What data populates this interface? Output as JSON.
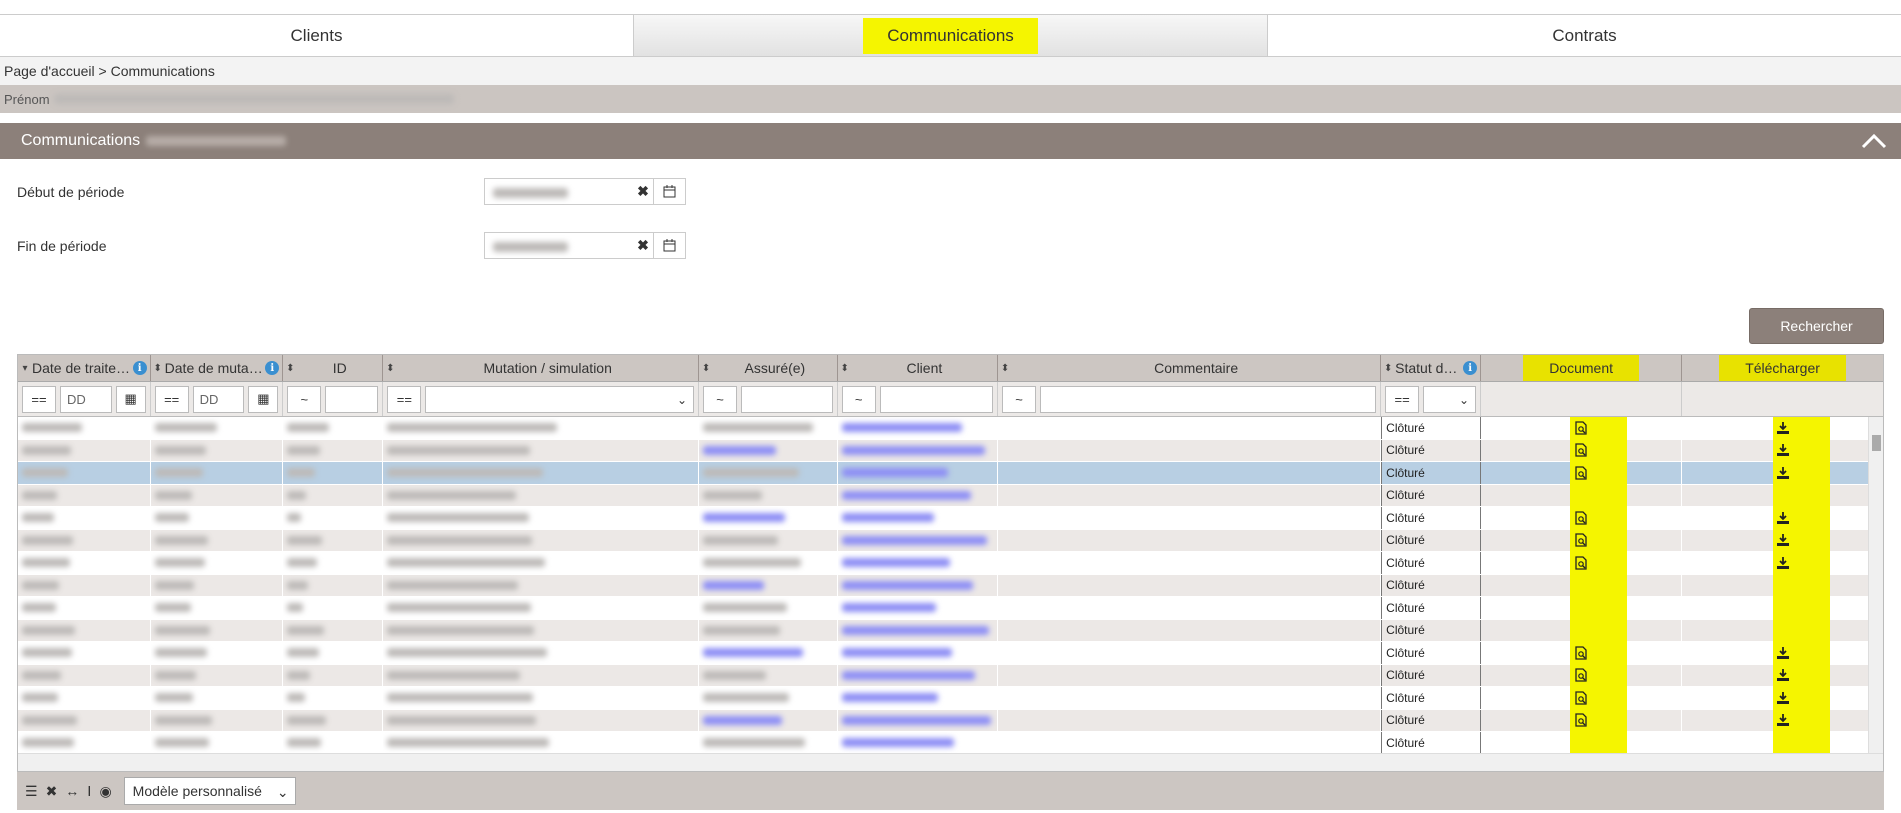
{
  "tabs": [
    {
      "label": "Clients",
      "active": false
    },
    {
      "label": "Communications",
      "active": true
    },
    {
      "label": "Contrats",
      "active": false
    }
  ],
  "breadcrumb": "Page d'accueil > Communications",
  "info_bar": {
    "label": "Prénom"
  },
  "section": {
    "title": "Communications"
  },
  "form": {
    "start_label": "Début de période",
    "end_label": "Fin de période"
  },
  "search_button": "Rechercher",
  "grid": {
    "columns": [
      {
        "label": "Date de traite…",
        "info": true
      },
      {
        "label": "Date de muta…",
        "info": true
      },
      {
        "label": "ID",
        "info": false
      },
      {
        "label": "Mutation / simulation",
        "info": false
      },
      {
        "label": "Assuré(e)",
        "info": false
      },
      {
        "label": "Client",
        "info": false
      },
      {
        "label": "Commentaire",
        "info": false
      },
      {
        "label": "Statut de…",
        "info": true
      },
      {
        "label": "Document",
        "info": false
      },
      {
        "label": "Télécharger",
        "info": false
      }
    ],
    "filters": {
      "date1_op": "==",
      "date1_placeholder": "DD",
      "date2_op": "==",
      "date2_placeholder": "DD",
      "id_op": "~",
      "mutation_op": "==",
      "assure_op": "~",
      "client_op": "~",
      "comment_op": "~",
      "statut_op": "=="
    },
    "rows": [
      {
        "statut": "Clôturé",
        "doc": true
      },
      {
        "statut": "Clôturé",
        "doc": true
      },
      {
        "statut": "Clôturé",
        "doc": true,
        "selected": true
      },
      {
        "statut": "Clôturé",
        "doc": false
      },
      {
        "statut": "Clôturé",
        "doc": true
      },
      {
        "statut": "Clôturé",
        "doc": true
      },
      {
        "statut": "Clôturé",
        "doc": true
      },
      {
        "statut": "Clôturé",
        "doc": false
      },
      {
        "statut": "Clôturé",
        "doc": false
      },
      {
        "statut": "Clôturé",
        "doc": false
      },
      {
        "statut": "Clôturé",
        "doc": true
      },
      {
        "statut": "Clôturé",
        "doc": true
      },
      {
        "statut": "Clôturé",
        "doc": true
      },
      {
        "statut": "Clôturé",
        "doc": true
      },
      {
        "statut": "Clôturé",
        "doc": false
      }
    ]
  },
  "footer": {
    "model_select": "Modèle personnalisé"
  },
  "colors": {
    "highlight": "#f5f500",
    "header_brown": "#8c807a",
    "link_blur": "#8d8ef5",
    "selected_row": "#b8cfe3"
  }
}
